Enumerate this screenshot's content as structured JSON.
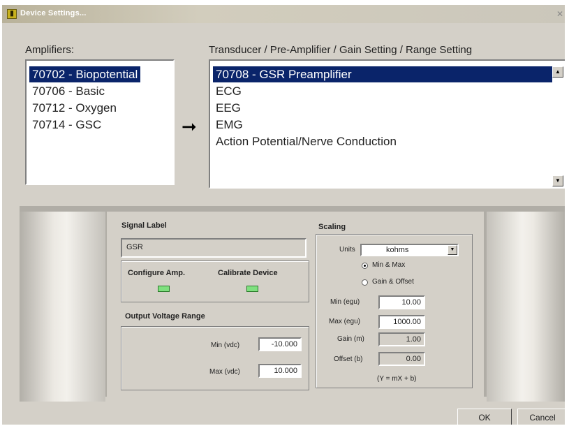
{
  "window": {
    "title": "Device Settings..."
  },
  "amplifiers": {
    "label": "Amplifiers:",
    "items": [
      "70702 - Biopotential",
      "70706 - Basic",
      "70712 - Oxygen",
      "70714 - GSC"
    ],
    "selected_index": 0
  },
  "transducers": {
    "label": "Transducer / Pre-Amplifier / Gain Setting / Range Setting",
    "items": [
      "70708 - GSR Preamplifier",
      "ECG",
      "EEG",
      "EMG",
      "Action Potential/Nerve Conduction"
    ],
    "selected_index": 0
  },
  "signal_label": {
    "title": "Signal Label",
    "value": "GSR"
  },
  "configure": {
    "configure_amp_label": "Configure Amp.",
    "calibrate_label": "Calibrate Device"
  },
  "output_voltage": {
    "title": "Output Voltage Range",
    "min_label": "Min (vdc)",
    "min_value": "-10.000",
    "max_label": "Max (vdc)",
    "max_value": "10.000"
  },
  "scaling": {
    "title": "Scaling",
    "units_label": "Units",
    "units_value": "kohms",
    "radio_min_max": "Min & Max",
    "radio_gain_offset": "Gain & Offset",
    "selected_mode": "min_max",
    "min_label": "Min (egu)",
    "min_value": "10.00",
    "max_label": "Max (egu)",
    "max_value": "1000.00",
    "gain_label": "Gain (m)",
    "gain_value": "1.00",
    "offset_label": "Offset (b)",
    "offset_value": "0.00",
    "formula": "(Y = mX + b)"
  },
  "buttons": {
    "ok": "OK",
    "cancel": "Cancel"
  },
  "colors": {
    "selection": "#0a246a",
    "led_green": "#7fe07f",
    "dialog_face": "#d4d0c8"
  }
}
